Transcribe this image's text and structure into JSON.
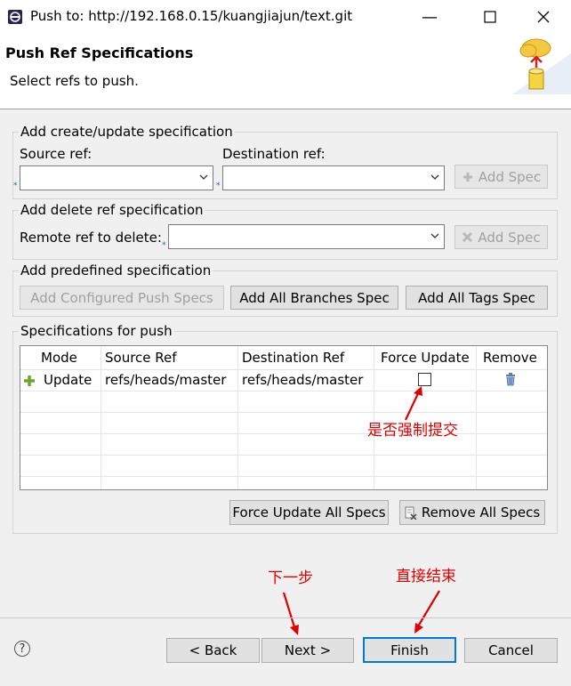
{
  "window": {
    "title": "Push to: http://192.168.0.15/kuangjiajun/text.git"
  },
  "header": {
    "title": "Push Ref Specifications",
    "subtitle": "Select refs to push."
  },
  "create_group": {
    "title": "Add create/update specification",
    "source_label": "Source ref:",
    "dest_label": "Destination ref:",
    "source_value": "",
    "dest_value": "",
    "add_spec": "Add Spec"
  },
  "delete_group": {
    "title": "Add delete ref specification",
    "remote_label": "Remote ref to delete:",
    "remote_value": "",
    "add_spec": "Add Spec"
  },
  "predefined_group": {
    "title": "Add predefined specification",
    "configured": "Add Configured Push Specs",
    "branches": "Add All Branches Spec",
    "tags": "Add All Tags Spec"
  },
  "specs_group": {
    "title": "Specifications for push",
    "columns": [
      "Mode",
      "Source Ref",
      "Destination Ref",
      "Force Update",
      "Remove"
    ],
    "rows": [
      {
        "mode": "Update",
        "source": "refs/heads/master",
        "dest": "refs/heads/master",
        "force": false
      }
    ],
    "force_all": "Force Update All Specs",
    "remove_all": "Remove All Specs"
  },
  "annotations": {
    "force_note": "是否强制提交",
    "next_note": "下一步",
    "finish_note": "直接结束",
    "color": "#e00000"
  },
  "footer": {
    "back": "< Back",
    "next": "Next >",
    "finish": "Finish",
    "cancel": "Cancel",
    "help": "?"
  }
}
